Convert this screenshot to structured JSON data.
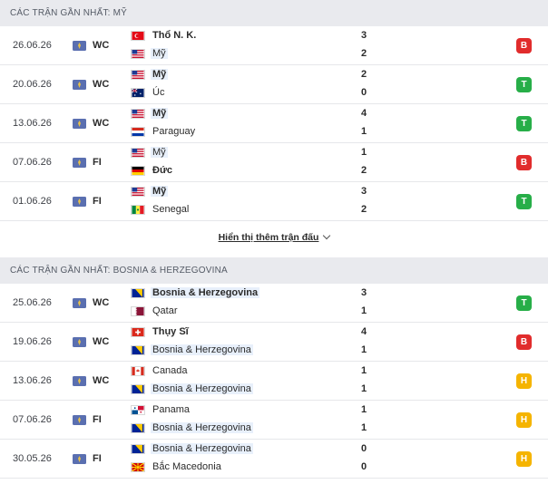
{
  "colors": {
    "win": "#27ae48",
    "loss": "#e12c2c",
    "draw": "#f5b400",
    "header_bg": "#e9eaee"
  },
  "section1": {
    "title": "CÁC TRẬN GẦN NHẤT: MỸ",
    "matches": [
      {
        "date": "26.06.26",
        "comp": "WC",
        "home": "Thổ N. K.",
        "home_flag": "turkey-flag",
        "away": "Mỹ",
        "away_flag": "usa-flag",
        "home_score": "3",
        "away_score": "2",
        "result": "B",
        "result_type": "loss"
      },
      {
        "date": "20.06.26",
        "comp": "WC",
        "home": "Mỹ",
        "home_flag": "usa-flag",
        "away": "Úc",
        "away_flag": "australia-flag",
        "home_score": "2",
        "away_score": "0",
        "result": "T",
        "result_type": "win"
      },
      {
        "date": "13.06.26",
        "comp": "WC",
        "home": "Mỹ",
        "home_flag": "usa-flag",
        "away": "Paraguay",
        "away_flag": "paraguay-flag",
        "home_score": "4",
        "away_score": "1",
        "result": "T",
        "result_type": "win"
      },
      {
        "date": "07.06.26",
        "comp": "FI",
        "home": "Mỹ",
        "home_flag": "usa-flag",
        "away": "Đức",
        "away_flag": "germany-flag",
        "home_score": "1",
        "away_score": "2",
        "result": "B",
        "result_type": "loss"
      },
      {
        "date": "01.06.26",
        "comp": "FI",
        "home": "Mỹ",
        "home_flag": "usa-flag",
        "away": "Senegal",
        "away_flag": "senegal-flag",
        "home_score": "3",
        "away_score": "2",
        "result": "T",
        "result_type": "win"
      }
    ],
    "show_more": "Hiển thị thêm trận đấu"
  },
  "section2": {
    "title": "CÁC TRẬN GẦN NHẤT: BOSNIA & HERZEGOVINA",
    "matches": [
      {
        "date": "25.06.26",
        "comp": "WC",
        "home": "Bosnia & Herzegovina",
        "home_flag": "bosnia-flag",
        "away": "Qatar",
        "away_flag": "qatar-flag",
        "home_score": "3",
        "away_score": "1",
        "result": "T",
        "result_type": "win"
      },
      {
        "date": "19.06.26",
        "comp": "WC",
        "home": "Thụy Sĩ",
        "home_flag": "switzerland-flag",
        "away": "Bosnia & Herzegovina",
        "away_flag": "bosnia-flag",
        "home_score": "4",
        "away_score": "1",
        "result": "B",
        "result_type": "loss"
      },
      {
        "date": "13.06.26",
        "comp": "WC",
        "home": "Canada",
        "home_flag": "canada-flag",
        "away": "Bosnia & Herzegovina",
        "away_flag": "bosnia-flag",
        "home_score": "1",
        "away_score": "1",
        "result": "H",
        "result_type": "draw"
      },
      {
        "date": "07.06.26",
        "comp": "FI",
        "home": "Panama",
        "home_flag": "panama-flag",
        "away": "Bosnia & Herzegovina",
        "away_flag": "bosnia-flag",
        "home_score": "1",
        "away_score": "1",
        "result": "H",
        "result_type": "draw"
      },
      {
        "date": "30.05.26",
        "comp": "FI",
        "home": "Bosnia & Herzegovina",
        "home_flag": "bosnia-flag",
        "away": "Bắc Macedonia",
        "away_flag": "north-macedonia-flag",
        "home_score": "0",
        "away_score": "0",
        "result": "H",
        "result_type": "draw"
      }
    ]
  }
}
